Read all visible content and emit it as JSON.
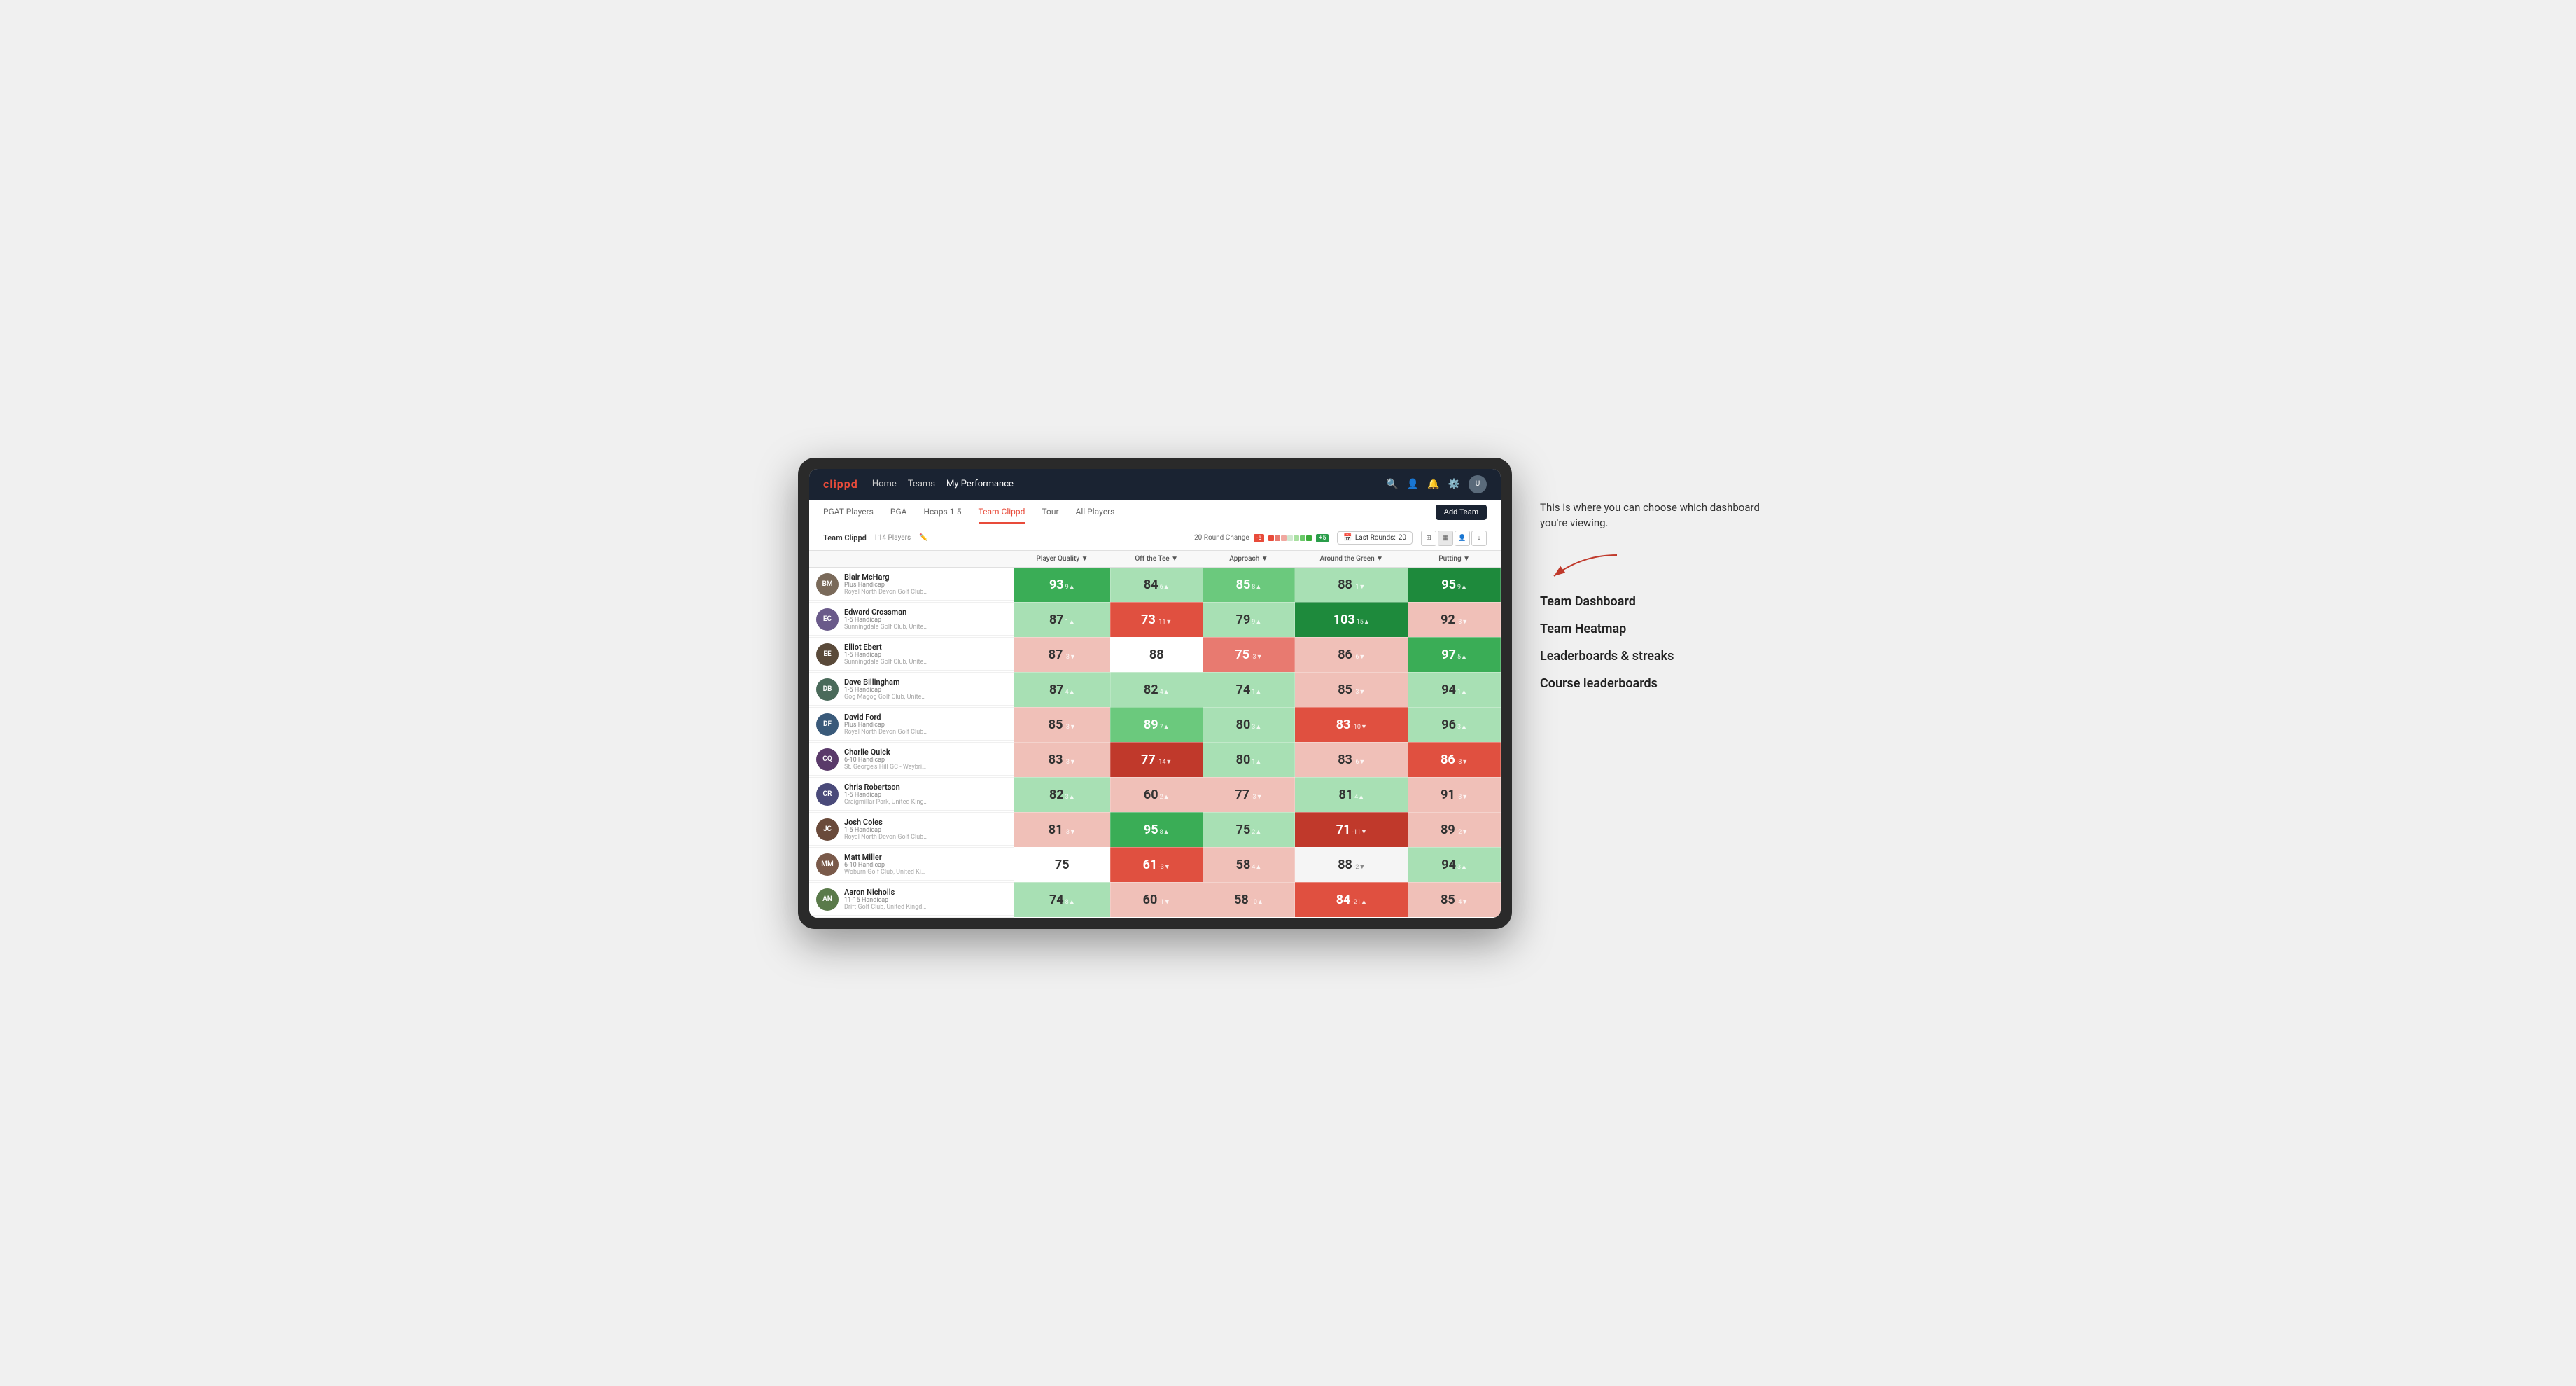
{
  "annotation": {
    "description": "This is where you can choose which dashboard you're viewing.",
    "arrow_direction": "pointing left"
  },
  "dashboard_options": [
    "Team Dashboard",
    "Team Heatmap",
    "Leaderboards & streaks",
    "Course leaderboards"
  ],
  "nav": {
    "logo": "clippd",
    "links": [
      "Home",
      "Teams",
      "My Performance"
    ],
    "active_link": "My Performance"
  },
  "sub_nav": {
    "tabs": [
      "PGAT Players",
      "PGA",
      "Hcaps 1-5",
      "Team Clippd",
      "Tour",
      "All Players"
    ],
    "active_tab": "Team Clippd",
    "add_team_label": "Add Team"
  },
  "team_bar": {
    "team_name": "Team Clippd",
    "player_count": "14 Players",
    "round_change_label": "20 Round Change",
    "change_neg": "-5",
    "change_pos": "+5",
    "last_rounds_label": "Last Rounds:",
    "last_rounds_value": "20"
  },
  "table": {
    "column_headers": [
      "Player Quality ▼",
      "Off the Tee ▼",
      "Approach ▼",
      "Around the Green ▼",
      "Putting ▼"
    ],
    "player_col_header": "",
    "players": [
      {
        "name": "Blair McHarg",
        "handicap": "Plus Handicap",
        "club": "Royal North Devon Golf Club, United Kingdom",
        "initials": "BM",
        "avatar_color": "#7a6a5a",
        "scores": [
          {
            "value": "93",
            "change": "9▲",
            "color": "green-mid"
          },
          {
            "value": "84",
            "change": "6▲",
            "color": "green-pale"
          },
          {
            "value": "85",
            "change": "8▲",
            "color": "green-light"
          },
          {
            "value": "88",
            "change": "-1▼",
            "color": "green-pale"
          },
          {
            "value": "95",
            "change": "9▲",
            "color": "green-dark"
          }
        ]
      },
      {
        "name": "Edward Crossman",
        "handicap": "1-5 Handicap",
        "club": "Sunningdale Golf Club, United Kingdom",
        "initials": "EC",
        "avatar_color": "#6a5a8a",
        "scores": [
          {
            "value": "87",
            "change": "1▲",
            "color": "green-pale"
          },
          {
            "value": "73",
            "change": "-11▼",
            "color": "red-mid"
          },
          {
            "value": "79",
            "change": "9▲",
            "color": "green-pale"
          },
          {
            "value": "103",
            "change": "15▲",
            "color": "green-dark"
          },
          {
            "value": "92",
            "change": "-3▼",
            "color": "red-pale"
          }
        ]
      },
      {
        "name": "Elliot Ebert",
        "handicap": "1-5 Handicap",
        "club": "Sunningdale Golf Club, United Kingdom",
        "initials": "EE",
        "avatar_color": "#5a4a3a",
        "scores": [
          {
            "value": "87",
            "change": "-3▼",
            "color": "red-pale"
          },
          {
            "value": "88",
            "change": "",
            "color": "white"
          },
          {
            "value": "75",
            "change": "-3▼",
            "color": "red-light"
          },
          {
            "value": "86",
            "change": "-6▼",
            "color": "red-pale"
          },
          {
            "value": "97",
            "change": "5▲",
            "color": "green-mid"
          }
        ]
      },
      {
        "name": "Dave Billingham",
        "handicap": "1-5 Handicap",
        "club": "Gog Magog Golf Club, United Kingdom",
        "initials": "DB",
        "avatar_color": "#4a6a5a",
        "scores": [
          {
            "value": "87",
            "change": "4▲",
            "color": "green-pale"
          },
          {
            "value": "82",
            "change": "4▲",
            "color": "green-pale"
          },
          {
            "value": "74",
            "change": "1▲",
            "color": "green-pale"
          },
          {
            "value": "85",
            "change": "-3▼",
            "color": "red-pale"
          },
          {
            "value": "94",
            "change": "1▲",
            "color": "green-pale"
          }
        ]
      },
      {
        "name": "David Ford",
        "handicap": "Plus Handicap",
        "club": "Royal North Devon Golf Club, United Kingdom",
        "initials": "DF",
        "avatar_color": "#3a5a7a",
        "scores": [
          {
            "value": "85",
            "change": "-3▼",
            "color": "red-pale"
          },
          {
            "value": "89",
            "change": "7▲",
            "color": "green-light"
          },
          {
            "value": "80",
            "change": "3▲",
            "color": "green-pale"
          },
          {
            "value": "83",
            "change": "-10▼",
            "color": "red-mid"
          },
          {
            "value": "96",
            "change": "3▲",
            "color": "green-pale"
          }
        ]
      },
      {
        "name": "Charlie Quick",
        "handicap": "6-10 Handicap",
        "club": "St. George's Hill GC - Weybridge, Surrey, Uni...",
        "initials": "CQ",
        "avatar_color": "#5a3a6a",
        "scores": [
          {
            "value": "83",
            "change": "-3▼",
            "color": "red-pale"
          },
          {
            "value": "77",
            "change": "-14▼",
            "color": "red-dark"
          },
          {
            "value": "80",
            "change": "1▲",
            "color": "green-pale"
          },
          {
            "value": "83",
            "change": "-6▼",
            "color": "red-pale"
          },
          {
            "value": "86",
            "change": "-8▼",
            "color": "red-mid"
          }
        ]
      },
      {
        "name": "Chris Robertson",
        "handicap": "1-5 Handicap",
        "club": "Craigmillar Park, United Kingdom",
        "initials": "CR",
        "avatar_color": "#4a4a7a",
        "scores": [
          {
            "value": "82",
            "change": "3▲",
            "color": "green-pale"
          },
          {
            "value": "60",
            "change": "2▲",
            "color": "red-pale"
          },
          {
            "value": "77",
            "change": "-3▼",
            "color": "red-pale"
          },
          {
            "value": "81",
            "change": "4▲",
            "color": "green-pale"
          },
          {
            "value": "91",
            "change": "-3▼",
            "color": "red-pale"
          }
        ]
      },
      {
        "name": "Josh Coles",
        "handicap": "1-5 Handicap",
        "club": "Royal North Devon Golf Club, United Kingdom",
        "initials": "JC",
        "avatar_color": "#6a4a3a",
        "scores": [
          {
            "value": "81",
            "change": "-3▼",
            "color": "red-pale"
          },
          {
            "value": "95",
            "change": "8▲",
            "color": "green-mid"
          },
          {
            "value": "75",
            "change": "2▲",
            "color": "green-pale"
          },
          {
            "value": "71",
            "change": "-11▼",
            "color": "red-dark"
          },
          {
            "value": "89",
            "change": "-2▼",
            "color": "red-pale"
          }
        ]
      },
      {
        "name": "Matt Miller",
        "handicap": "6-10 Handicap",
        "club": "Woburn Golf Club, United Kingdom",
        "initials": "MM",
        "avatar_color": "#7a5a4a",
        "scores": [
          {
            "value": "75",
            "change": "",
            "color": "white"
          },
          {
            "value": "61",
            "change": "-3▼",
            "color": "red-mid"
          },
          {
            "value": "58",
            "change": "4▲",
            "color": "red-pale"
          },
          {
            "value": "88",
            "change": "-2▼",
            "color": "white-gray"
          },
          {
            "value": "94",
            "change": "3▲",
            "color": "green-pale"
          }
        ]
      },
      {
        "name": "Aaron Nicholls",
        "handicap": "11-15 Handicap",
        "club": "Drift Golf Club, United Kingdom",
        "initials": "AN",
        "avatar_color": "#5a7a4a",
        "scores": [
          {
            "value": "74",
            "change": "8▲",
            "color": "green-pale"
          },
          {
            "value": "60",
            "change": "-1▼",
            "color": "red-pale"
          },
          {
            "value": "58",
            "change": "10▲",
            "color": "red-pale"
          },
          {
            "value": "84",
            "change": "-21▲",
            "color": "red-mid"
          },
          {
            "value": "85",
            "change": "-4▼",
            "color": "red-pale"
          }
        ]
      }
    ]
  }
}
